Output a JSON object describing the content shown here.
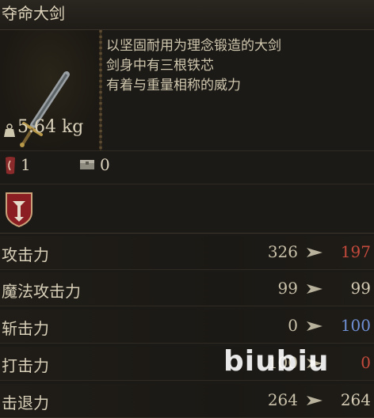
{
  "item": {
    "name": "夺命大剑",
    "weight": "5.64 kg",
    "description": [
      "以坚固耐用为理念锻造的大剑",
      "剑身中有三根铁芯",
      "有着与重量相称的威力"
    ],
    "requirement_value": "1",
    "storage_value": "0"
  },
  "stats": [
    {
      "label": "攻击力",
      "current": "326",
      "new": "197",
      "new_color": "#c44a3c"
    },
    {
      "label": "魔法攻击力",
      "current": "99",
      "new": "99",
      "new_color": "#d6cdb6"
    },
    {
      "label": "斩击力",
      "current": "0",
      "new": "100",
      "new_color": "#6f90d4"
    },
    {
      "label": "打击力",
      "current": "100",
      "new": "0",
      "new_color": "#c44a3c"
    },
    {
      "label": "击退力",
      "current": "264",
      "new": "264",
      "new_color": "#d6cdb6"
    }
  ],
  "watermark": "biubiu",
  "icons": [
    "sword-icon",
    "weight-icon",
    "requirement-icon",
    "storage-box-icon",
    "faction-shield-icon",
    "arrow-icon"
  ]
}
